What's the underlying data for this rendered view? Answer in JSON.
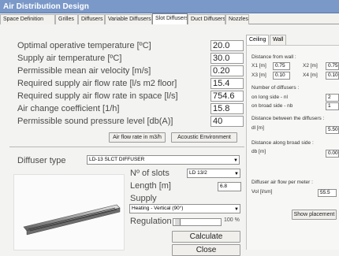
{
  "window": {
    "title": "Air Distribution Design"
  },
  "tabs": [
    "Space Definition",
    "Grilles",
    "Diffusers",
    "Variable Diffusers",
    "Slot Diffusers",
    "Duct Diffusers",
    "Nozzles"
  ],
  "active_tab": "Slot Diffusers",
  "params": [
    {
      "label": "Optimal operative temperature   [ºC]",
      "value": "20.0"
    },
    {
      "label": "Supply air temperature   [ºC]",
      "value": "30.0"
    },
    {
      "label": "Permissible mean air velocity  [m/s]",
      "value": "0.20"
    },
    {
      "label": "Required supply air flow rate  [l/s m2 floor]",
      "value": "15.4"
    },
    {
      "label": "Required supply air flow rate in space   [l/s]",
      "value": "754.6"
    },
    {
      "label": "Air change coefficient  [1/h]",
      "value": "15.8"
    },
    {
      "label": "Permissible sound pressure level  [db(A)]",
      "value": "40"
    }
  ],
  "buttons": {
    "airflow": "Air flow rate  in m3/h",
    "acoustic": "Acoustic Environment",
    "calculate": "Calculate",
    "close": "Close",
    "show_placement": "Show placement"
  },
  "diffuser": {
    "type_label": "Diffuser type",
    "type_value": "LD-13  SLCT DIFFUSER",
    "slots_label": "Nº of slots",
    "slots_value": "LD 13/2",
    "length_label": "Length  [m]",
    "length_value": "6.8",
    "supply_label": "Supply",
    "supply_value": "Heating - Vertical (90°)",
    "regulation_label": "Regulation",
    "regulation_percent": "100 %",
    "regulation_level": 0.04
  },
  "right_panel": {
    "tabs": [
      "Ceiling",
      "Wall"
    ],
    "distance_wall": "Distance from wall :",
    "x1_label": "X1  [m]",
    "x1_value": "0.75",
    "x2_label": "X2  [m]",
    "x2_value": "0.75",
    "x3_label": "X3  [m]",
    "x3_value": "0.10",
    "x4_label": "X4  [m]",
    "x4_value": "0.10",
    "num_diffusers": "Number of diffusers :",
    "long_side_label": "on long side - nl",
    "long_side_value": "2",
    "broad_side_label": "on broad side - nb",
    "broad_side_value": "1",
    "dist_between": "Distance between the diffusers :",
    "dl_label": "dl  [m]",
    "dl_value": "5.50",
    "dist_broad": "Distance along broad side :",
    "db_label": "db  [m]",
    "db_value": "0.00",
    "airflow_label": "Diffuser air flow per meter :",
    "vol_label": "Vol  [l/sm]",
    "vol_value": "55.5"
  },
  "colors": {
    "titlebar": "#7a98c8",
    "panel": "#f3f3f1"
  }
}
